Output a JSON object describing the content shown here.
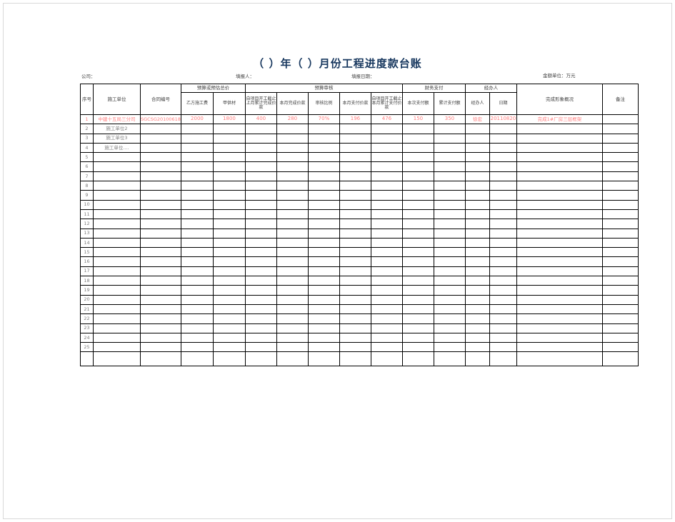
{
  "document": {
    "title": "（    ）年（    ）月份工程进度款台账",
    "meta": {
      "company_label": "公司：",
      "filler_label": "填报人：",
      "date_label": "填报日期：",
      "amount_unit_label": "金额单位：万元"
    }
  },
  "table": {
    "group_headers": {
      "seq": "序号",
      "construction_unit": "施工单位",
      "contract_no": "合同编号",
      "budget_total": "预算或预估总价",
      "budget_review": "预算审核",
      "finance_payment": "财务支付",
      "handler_group": "经办人",
      "progress_summary": "完成形象概况",
      "remarks": "备注"
    },
    "sub_headers": {
      "party_b_fee": "乙方施工费",
      "party_a_material": "甲供材",
      "accum_last_month_completed": "自项目开工截止上月累计完成价款",
      "current_month_completed": "本月完成价款",
      "review_ratio": "审核比例",
      "current_month_payment": "本月支付价款",
      "accum_this_month_payment": "自项目开工截止本月累计支付价款",
      "current_payment_amount": "本次支付额",
      "accum_payment_amount": "累计支付额",
      "handler": "经办人",
      "date": "日期"
    },
    "rows": [
      {
        "seq": "1",
        "construction_unit": "中建十五局三分司",
        "contract_no": "SGCSG20100618",
        "party_b_fee": "2000",
        "party_a_material": "1800",
        "accum_last_month_completed": "400",
        "current_month_completed": "280",
        "review_ratio": "70%",
        "current_month_payment": "196",
        "accum_this_month_payment": "476",
        "current_payment_amount": "150",
        "accum_payment_amount": "350",
        "handler": "徐宏",
        "date": "20110820",
        "progress_summary": "完成1#厂房三层框架",
        "remarks": ""
      },
      {
        "seq": "2",
        "construction_unit": "施工单位2",
        "contract_no": "",
        "party_b_fee": "",
        "party_a_material": "",
        "accum_last_month_completed": "",
        "current_month_completed": "",
        "review_ratio": "",
        "current_month_payment": "",
        "accum_this_month_payment": "",
        "current_payment_amount": "",
        "accum_payment_amount": "",
        "handler": "",
        "date": "",
        "progress_summary": "",
        "remarks": ""
      },
      {
        "seq": "3",
        "construction_unit": "施工单位3",
        "contract_no": "",
        "party_b_fee": "",
        "party_a_material": "",
        "accum_last_month_completed": "",
        "current_month_completed": "",
        "review_ratio": "",
        "current_month_payment": "",
        "accum_this_month_payment": "",
        "current_payment_amount": "",
        "accum_payment_amount": "",
        "handler": "",
        "date": "",
        "progress_summary": "",
        "remarks": ""
      },
      {
        "seq": "4",
        "construction_unit": "施工单位....",
        "contract_no": "",
        "party_b_fee": "",
        "party_a_material": "",
        "accum_last_month_completed": "",
        "current_month_completed": "",
        "review_ratio": "",
        "current_month_payment": "",
        "accum_this_month_payment": "",
        "current_payment_amount": "",
        "accum_payment_amount": "",
        "handler": "",
        "date": "",
        "progress_summary": "",
        "remarks": ""
      },
      {
        "seq": "5",
        "construction_unit": ""
      },
      {
        "seq": "6",
        "construction_unit": ""
      },
      {
        "seq": "7",
        "construction_unit": ""
      },
      {
        "seq": "8",
        "construction_unit": ""
      },
      {
        "seq": "9",
        "construction_unit": ""
      },
      {
        "seq": "10",
        "construction_unit": ""
      },
      {
        "seq": "11",
        "construction_unit": ""
      },
      {
        "seq": "12",
        "construction_unit": ""
      },
      {
        "seq": "13",
        "construction_unit": ""
      },
      {
        "seq": "14",
        "construction_unit": ""
      },
      {
        "seq": "15",
        "construction_unit": ""
      },
      {
        "seq": "16",
        "construction_unit": ""
      },
      {
        "seq": "17",
        "construction_unit": ""
      },
      {
        "seq": "18",
        "construction_unit": ""
      },
      {
        "seq": "19",
        "construction_unit": ""
      },
      {
        "seq": "20",
        "construction_unit": ""
      },
      {
        "seq": "21",
        "construction_unit": ""
      },
      {
        "seq": "22",
        "construction_unit": ""
      },
      {
        "seq": "23",
        "construction_unit": ""
      },
      {
        "seq": "24",
        "construction_unit": ""
      },
      {
        "seq": "25",
        "construction_unit": ""
      },
      {
        "seq": "",
        "construction_unit": ""
      }
    ]
  },
  "colors": {
    "title": "#17375e",
    "data_text": "#ff8080",
    "header_text": "#404040",
    "grid_line": "#000000"
  }
}
